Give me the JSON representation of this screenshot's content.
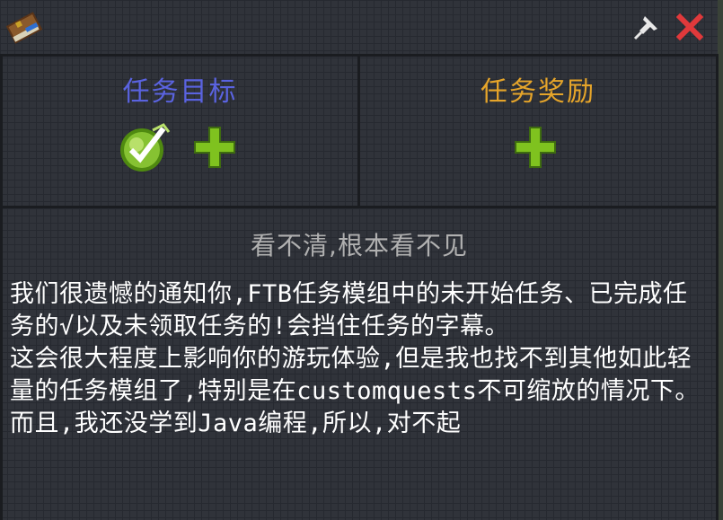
{
  "window": {
    "icons": {
      "book": "quest-book-icon",
      "pin": "pin-icon",
      "close": "close-icon"
    }
  },
  "tasks_panel": {
    "title": "任务目标",
    "title_color": "#5a63e0",
    "items": [
      "checkmark-complete-icon",
      "add-plus-icon"
    ]
  },
  "rewards_panel": {
    "title": "任务奖励",
    "title_color": "#e6a52a",
    "items": [
      "add-plus-icon"
    ]
  },
  "description": {
    "title": "看不清,根本看不见",
    "body": "我们很遗憾的通知你,FTB任务模组中的未开始任务、已完成任务的√以及未领取任务的!会挡住任务的字幕。\n这会很大程度上影响你的游玩体验,但是我也找不到其他如此轻量的任务模组了,特别是在customquests不可缩放的情况下。而且,我还没学到Java编程,所以,对不起"
  },
  "colors": {
    "background": "#30333a",
    "grid": "#262930",
    "border": "#1a1c20",
    "plus_green": "#7fc21f",
    "close_red": "#e0393b"
  }
}
